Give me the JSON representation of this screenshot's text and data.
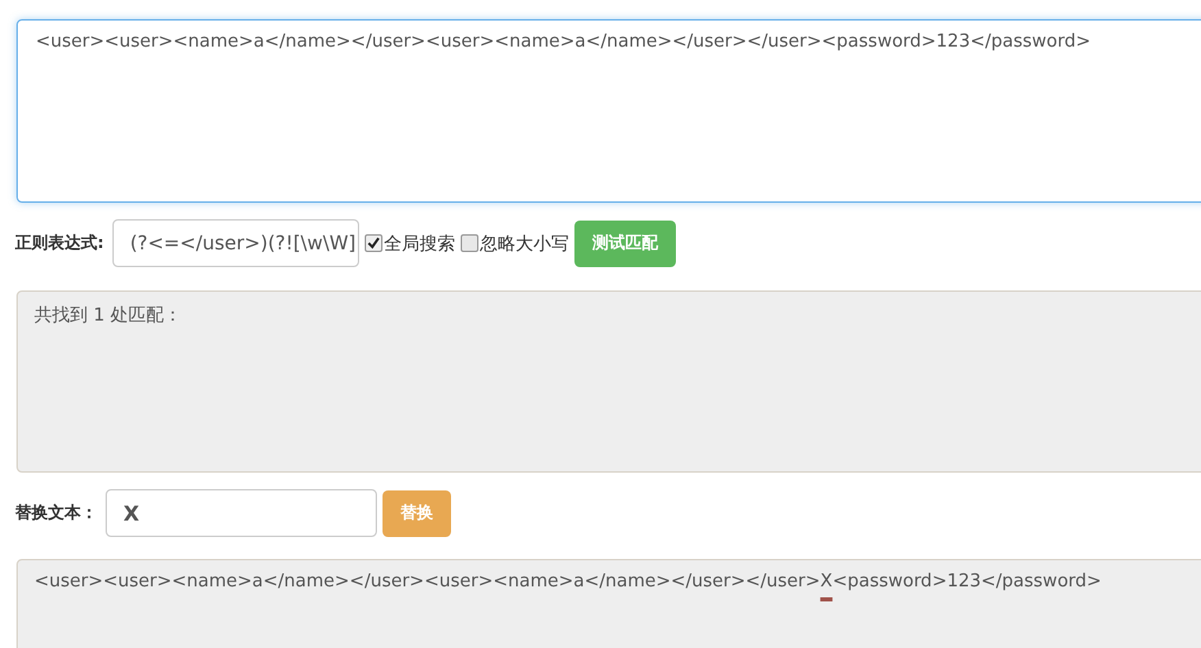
{
  "source_text": {
    "value": "<user><user><name>a</name></user><user><name>a</name></user></user><password>123</password>",
    "focused": true
  },
  "regex": {
    "label": "正则表达式:",
    "value": "(?<=</user>)(?![\\w\\W]",
    "options": [
      {
        "label": "全局搜索",
        "checked": true
      },
      {
        "label": "忽略大小写",
        "checked": false
      }
    ],
    "button": "测试匹配"
  },
  "match_result": {
    "text": "共找到 1 处匹配："
  },
  "replace": {
    "label": "替换文本：",
    "value": "X",
    "button": "替换"
  },
  "replace_result": {
    "before": "<user><user><name>a</name></user><user><name>a</name></user></user>",
    "replacement": "X",
    "after": "<password>123</password>"
  }
}
